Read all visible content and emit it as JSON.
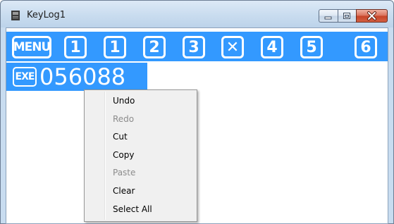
{
  "window": {
    "title": "KeyLog1",
    "icon": "notebook-icon",
    "buttons": [
      "minimize-icon",
      "maximize-icon",
      "close-icon"
    ]
  },
  "editor": {
    "selection_color": "#3399ff",
    "line1": {
      "menu_key": "MENU",
      "keys": [
        "1",
        "1",
        "2",
        "3",
        "✕",
        "4",
        "5",
        "6"
      ]
    },
    "line2": {
      "exe_key": "EXE",
      "value": "056088"
    }
  },
  "context_menu": {
    "items": [
      {
        "label": "Undo",
        "enabled": true
      },
      {
        "label": "Redo",
        "enabled": false
      },
      {
        "label": "Cut",
        "enabled": true
      },
      {
        "label": "Copy",
        "enabled": true
      },
      {
        "label": "Paste",
        "enabled": false
      },
      {
        "label": "Clear",
        "enabled": true
      },
      {
        "label": "Select All",
        "enabled": true
      }
    ]
  }
}
